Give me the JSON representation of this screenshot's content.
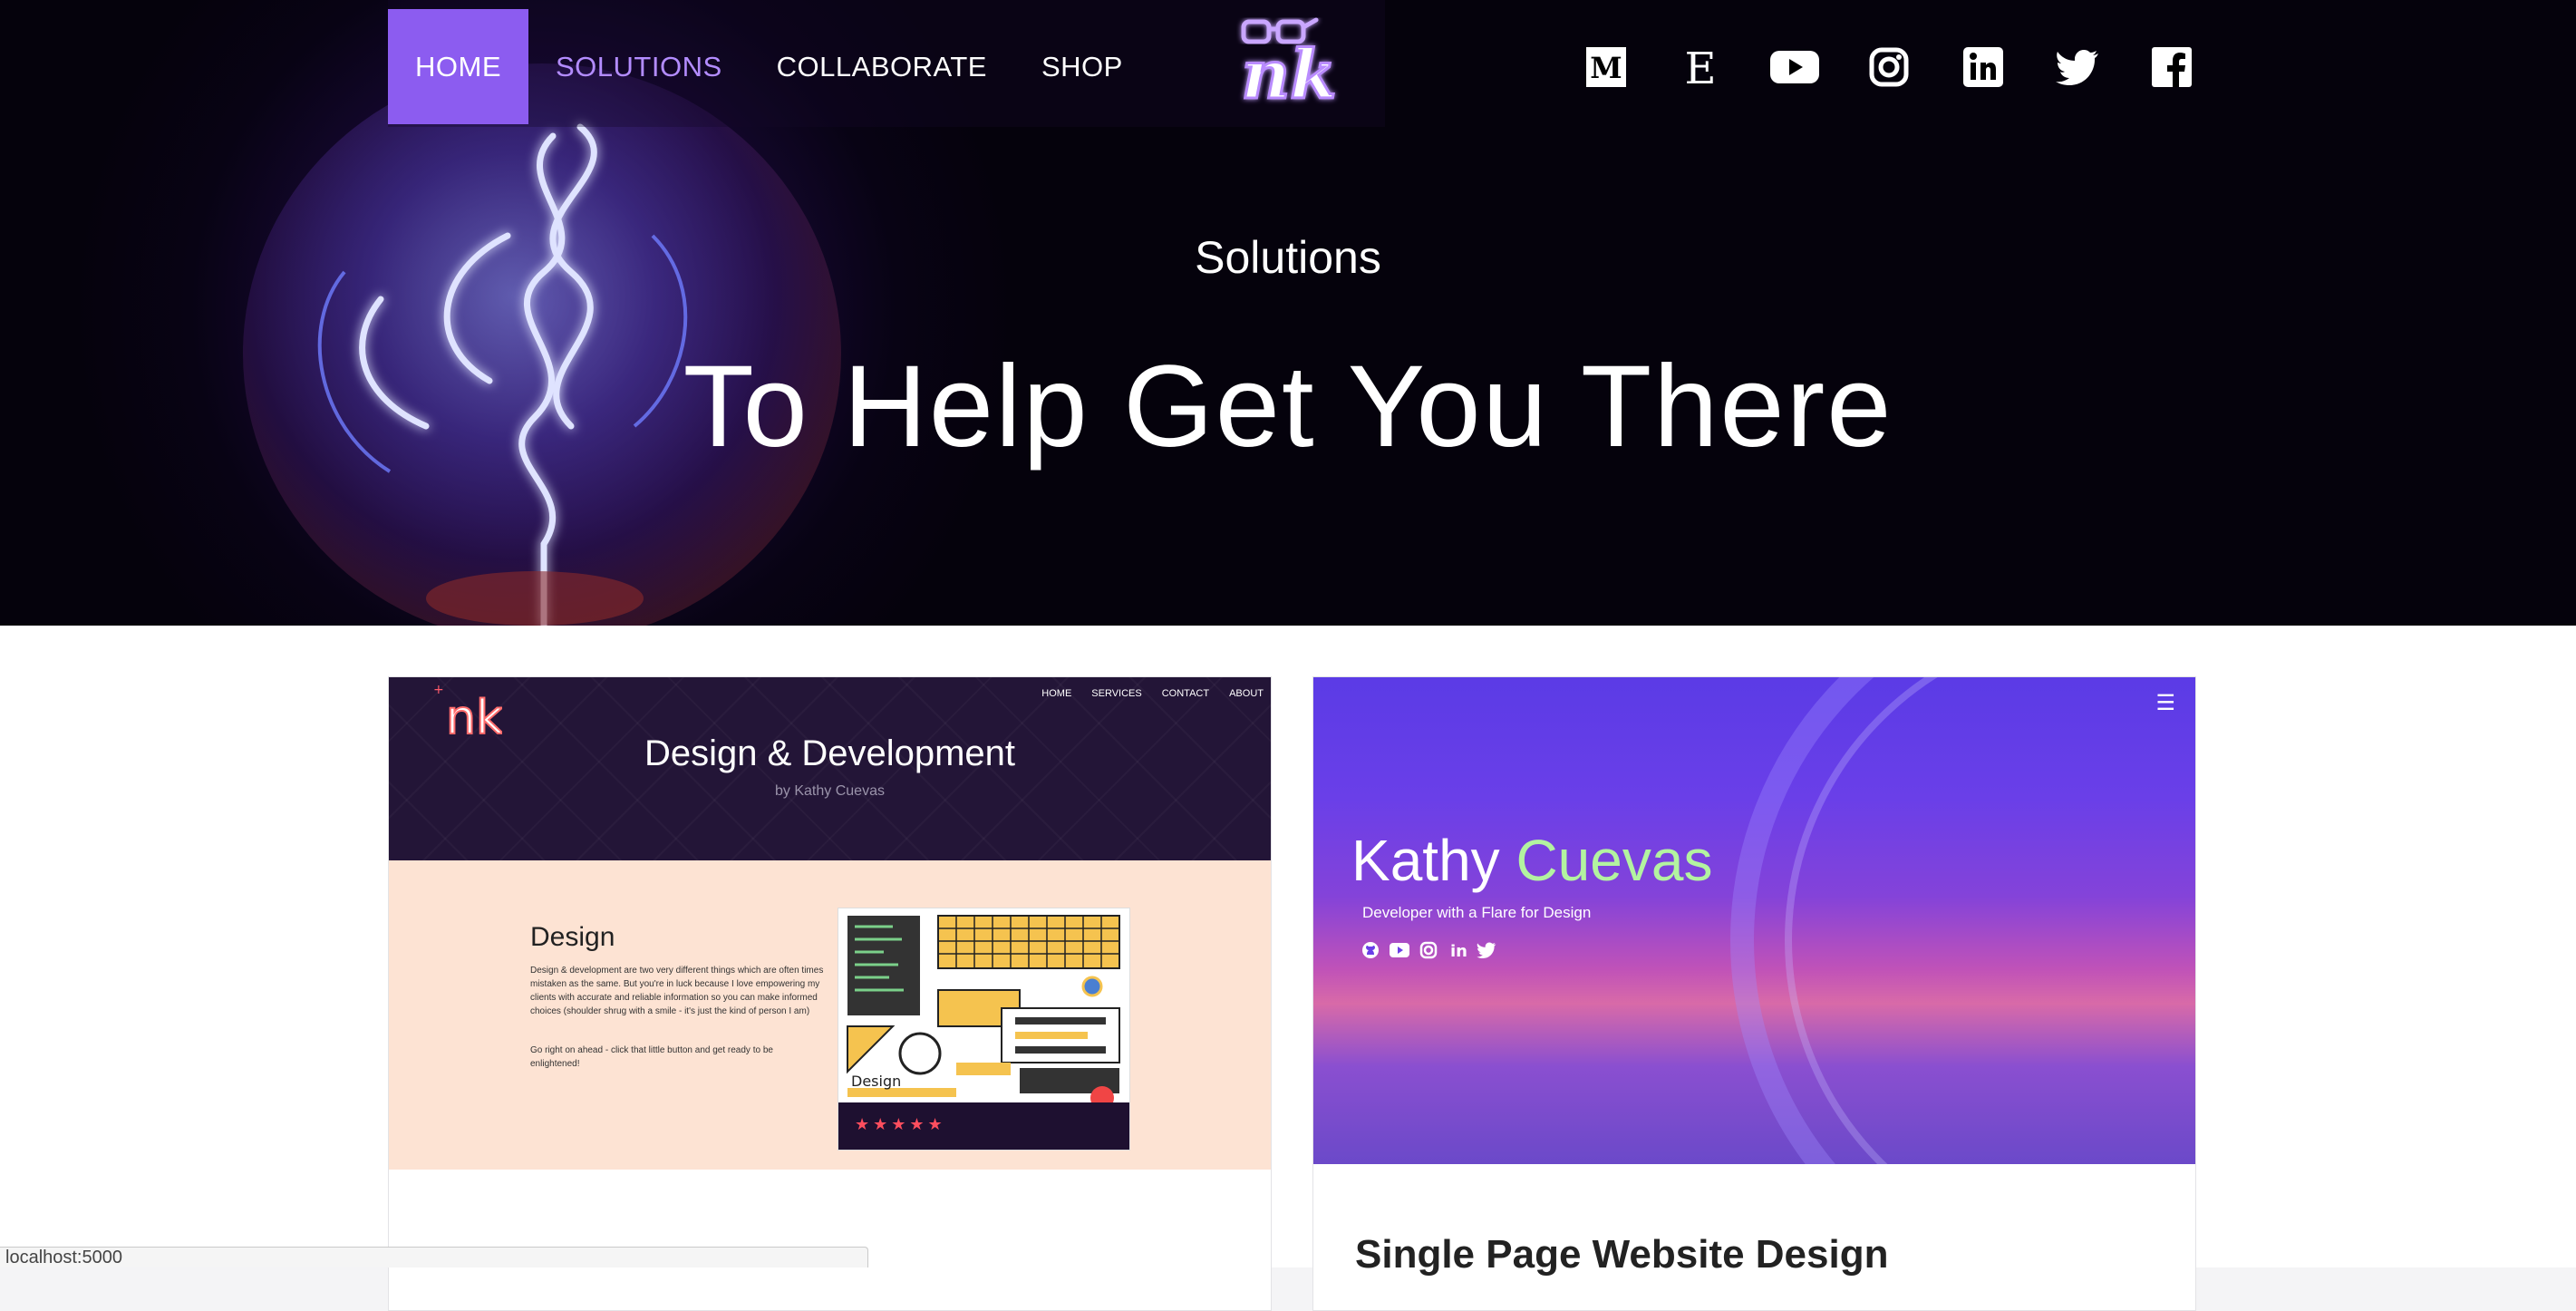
{
  "nav": {
    "items": [
      {
        "label": "HOME",
        "state": "active"
      },
      {
        "label": "SOLUTIONS",
        "state": "accent"
      },
      {
        "label": "COLLABORATE",
        "state": "normal"
      },
      {
        "label": "SHOP",
        "state": "normal"
      }
    ]
  },
  "logo": {
    "text": "nk",
    "icon": "glasses-logo"
  },
  "socials": [
    "medium-icon",
    "etsy-icon",
    "youtube-icon",
    "instagram-icon",
    "linkedin-icon",
    "twitter-icon",
    "facebook-icon"
  ],
  "hero": {
    "subtitle": "Solutions",
    "title": "To Help Get You There"
  },
  "cards": [
    {
      "thumbnail": {
        "nav": [
          "HOME",
          "SERVICES",
          "CONTACT",
          "ABOUT"
        ],
        "title": "Design & Development",
        "byline": "by Kathy Cuevas",
        "section_heading": "Design",
        "paragraph": "Design & development are two very different things which are often times mistaken as the same. But you're in luck because I love empowering my clients with accurate and reliable information so you can make informed choices (shoulder shrug with a smile - it's just the kind of person I am)",
        "paragraph2": "Go right on ahead - click that little button and get ready to be enlightened!",
        "art_label": "Design",
        "stars": "★★★★★"
      }
    },
    {
      "thumbnail": {
        "name_first": "Kathy",
        "name_last": "Cuevas",
        "tagline": "Developer with a Flare for Design",
        "icons": [
          "github-icon",
          "youtube-icon",
          "instagram-icon",
          "linkedin-icon",
          "twitter-icon"
        ]
      },
      "title": "Single Page Website Design"
    }
  ],
  "status_bar": {
    "url": "localhost:5000"
  },
  "colors": {
    "accent": "#8c5cf0",
    "accent_text": "#b38cff",
    "hero_bg": "#0b0418",
    "name_highlight": "#b3f3a0"
  }
}
